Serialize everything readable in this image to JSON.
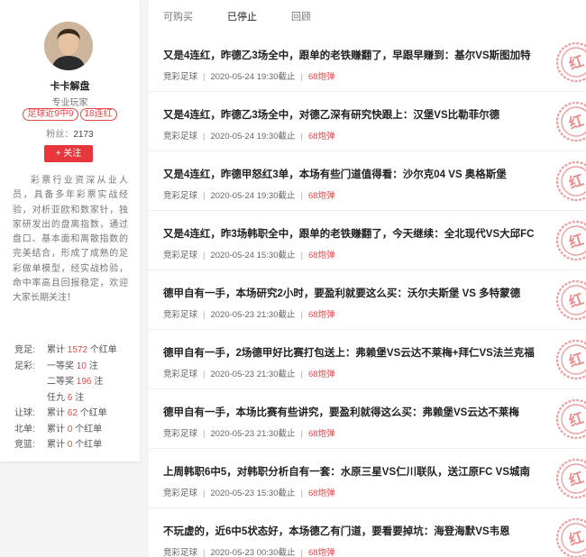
{
  "profile": {
    "name": "卡卡解盘",
    "role": "专业玩家",
    "badges": [
      "足球近9中9",
      "18连红"
    ],
    "fans_label": "粉丝：",
    "fans_count": "2173",
    "follow_label": "+ 关注",
    "bio": "彩票行业资深从业人员，具备多年彩票实战经验，对析亚欧和数家针，独家研发出的盘离指数，通过盘口、基本面和离散指数的完美结合，形成了成熟的足彩做单模型，经实战检验，命中率高且回报稳定，欢迎大家长期关注！",
    "stats": [
      {
        "label": "竞足:",
        "prefix": "累计",
        "value": "1572",
        "suffix": "个红单"
      },
      {
        "label": "足彩:",
        "prefix": "一等奖",
        "value": "10",
        "suffix": "注"
      },
      {
        "label": "",
        "prefix": "二等奖",
        "value": "196",
        "suffix": "注"
      },
      {
        "label": "",
        "prefix": "任九",
        "value": "6",
        "suffix": "注"
      },
      {
        "label": "让球:",
        "prefix": "累计",
        "value": "62",
        "suffix": "个红单"
      },
      {
        "label": "北单:",
        "prefix": "累计",
        "value": "0",
        "suffix": "个红单"
      },
      {
        "label": "竞篮:",
        "prefix": "累计",
        "value": "0",
        "suffix": "个红单"
      }
    ]
  },
  "tabs": [
    "可购买",
    "已停止",
    "回顾"
  ],
  "active_tab": "已停止",
  "articles": [
    {
      "title": "又是4连红，昨德乙3场全中，跟单的老铁赚翻了，早跟早赚到：基尔VS斯图加特",
      "category": "竞彩足球",
      "time": "2020-05-24 19:30截止",
      "status": "68炮弹"
    },
    {
      "title": "又是4连红，昨德乙3场全中，对德乙深有研究快跟上：汉堡VS比勒菲尔德",
      "category": "竞彩足球",
      "time": "2020-05-24 19:30截止",
      "status": "68炮弹"
    },
    {
      "title": "又是4连红，昨德甲怒红3单，本场有些门道值得看：沙尔克04 VS 奥格斯堡",
      "category": "竞彩足球",
      "time": "2020-05-24 19:30截止",
      "status": "68炮弹"
    },
    {
      "title": "又是4连红，昨3场韩职全中，跟单的老铁赚翻了，今天继续：全北现代VS大邱FC",
      "category": "竞彩足球",
      "time": "2020-05-24 15:30截止",
      "status": "68炮弹"
    },
    {
      "title": "德甲自有一手，本场研究2小时，要盈利就要这么买：沃尔夫斯堡 VS 多特蒙德",
      "category": "竞彩足球",
      "time": "2020-05-23 21:30截止",
      "status": "68炮弹"
    },
    {
      "title": "德甲自有一手，2场德甲好比赛打包送上：弗赖堡VS云达不莱梅+拜仁VS法兰克福",
      "category": "竞彩足球",
      "time": "2020-05-23 21:30截止",
      "status": "68炮弹"
    },
    {
      "title": "德甲自有一手，本场比赛有些讲究，要盈利就得这么买：弗赖堡VS云达不莱梅",
      "category": "竞彩足球",
      "time": "2020-05-23 21:30截止",
      "status": "68炮弹"
    },
    {
      "title": "上周韩职6中5，对韩职分析自有一套：水原三星VS仁川联队，送江原FC VS城南",
      "category": "竞彩足球",
      "time": "2020-05-23 15:30截止",
      "status": "68炮弹"
    },
    {
      "title": "不玩虚的，近6中5状态好，本场德乙有门道，要看要掉坑：海登海默VS韦恩",
      "category": "竞彩足球",
      "time": "2020-05-23 00:30截止",
      "status": "68炮弹"
    }
  ],
  "stamp_char": "红",
  "colors": {
    "accent": "#e8363d",
    "stamp": "#e9a0a0"
  }
}
